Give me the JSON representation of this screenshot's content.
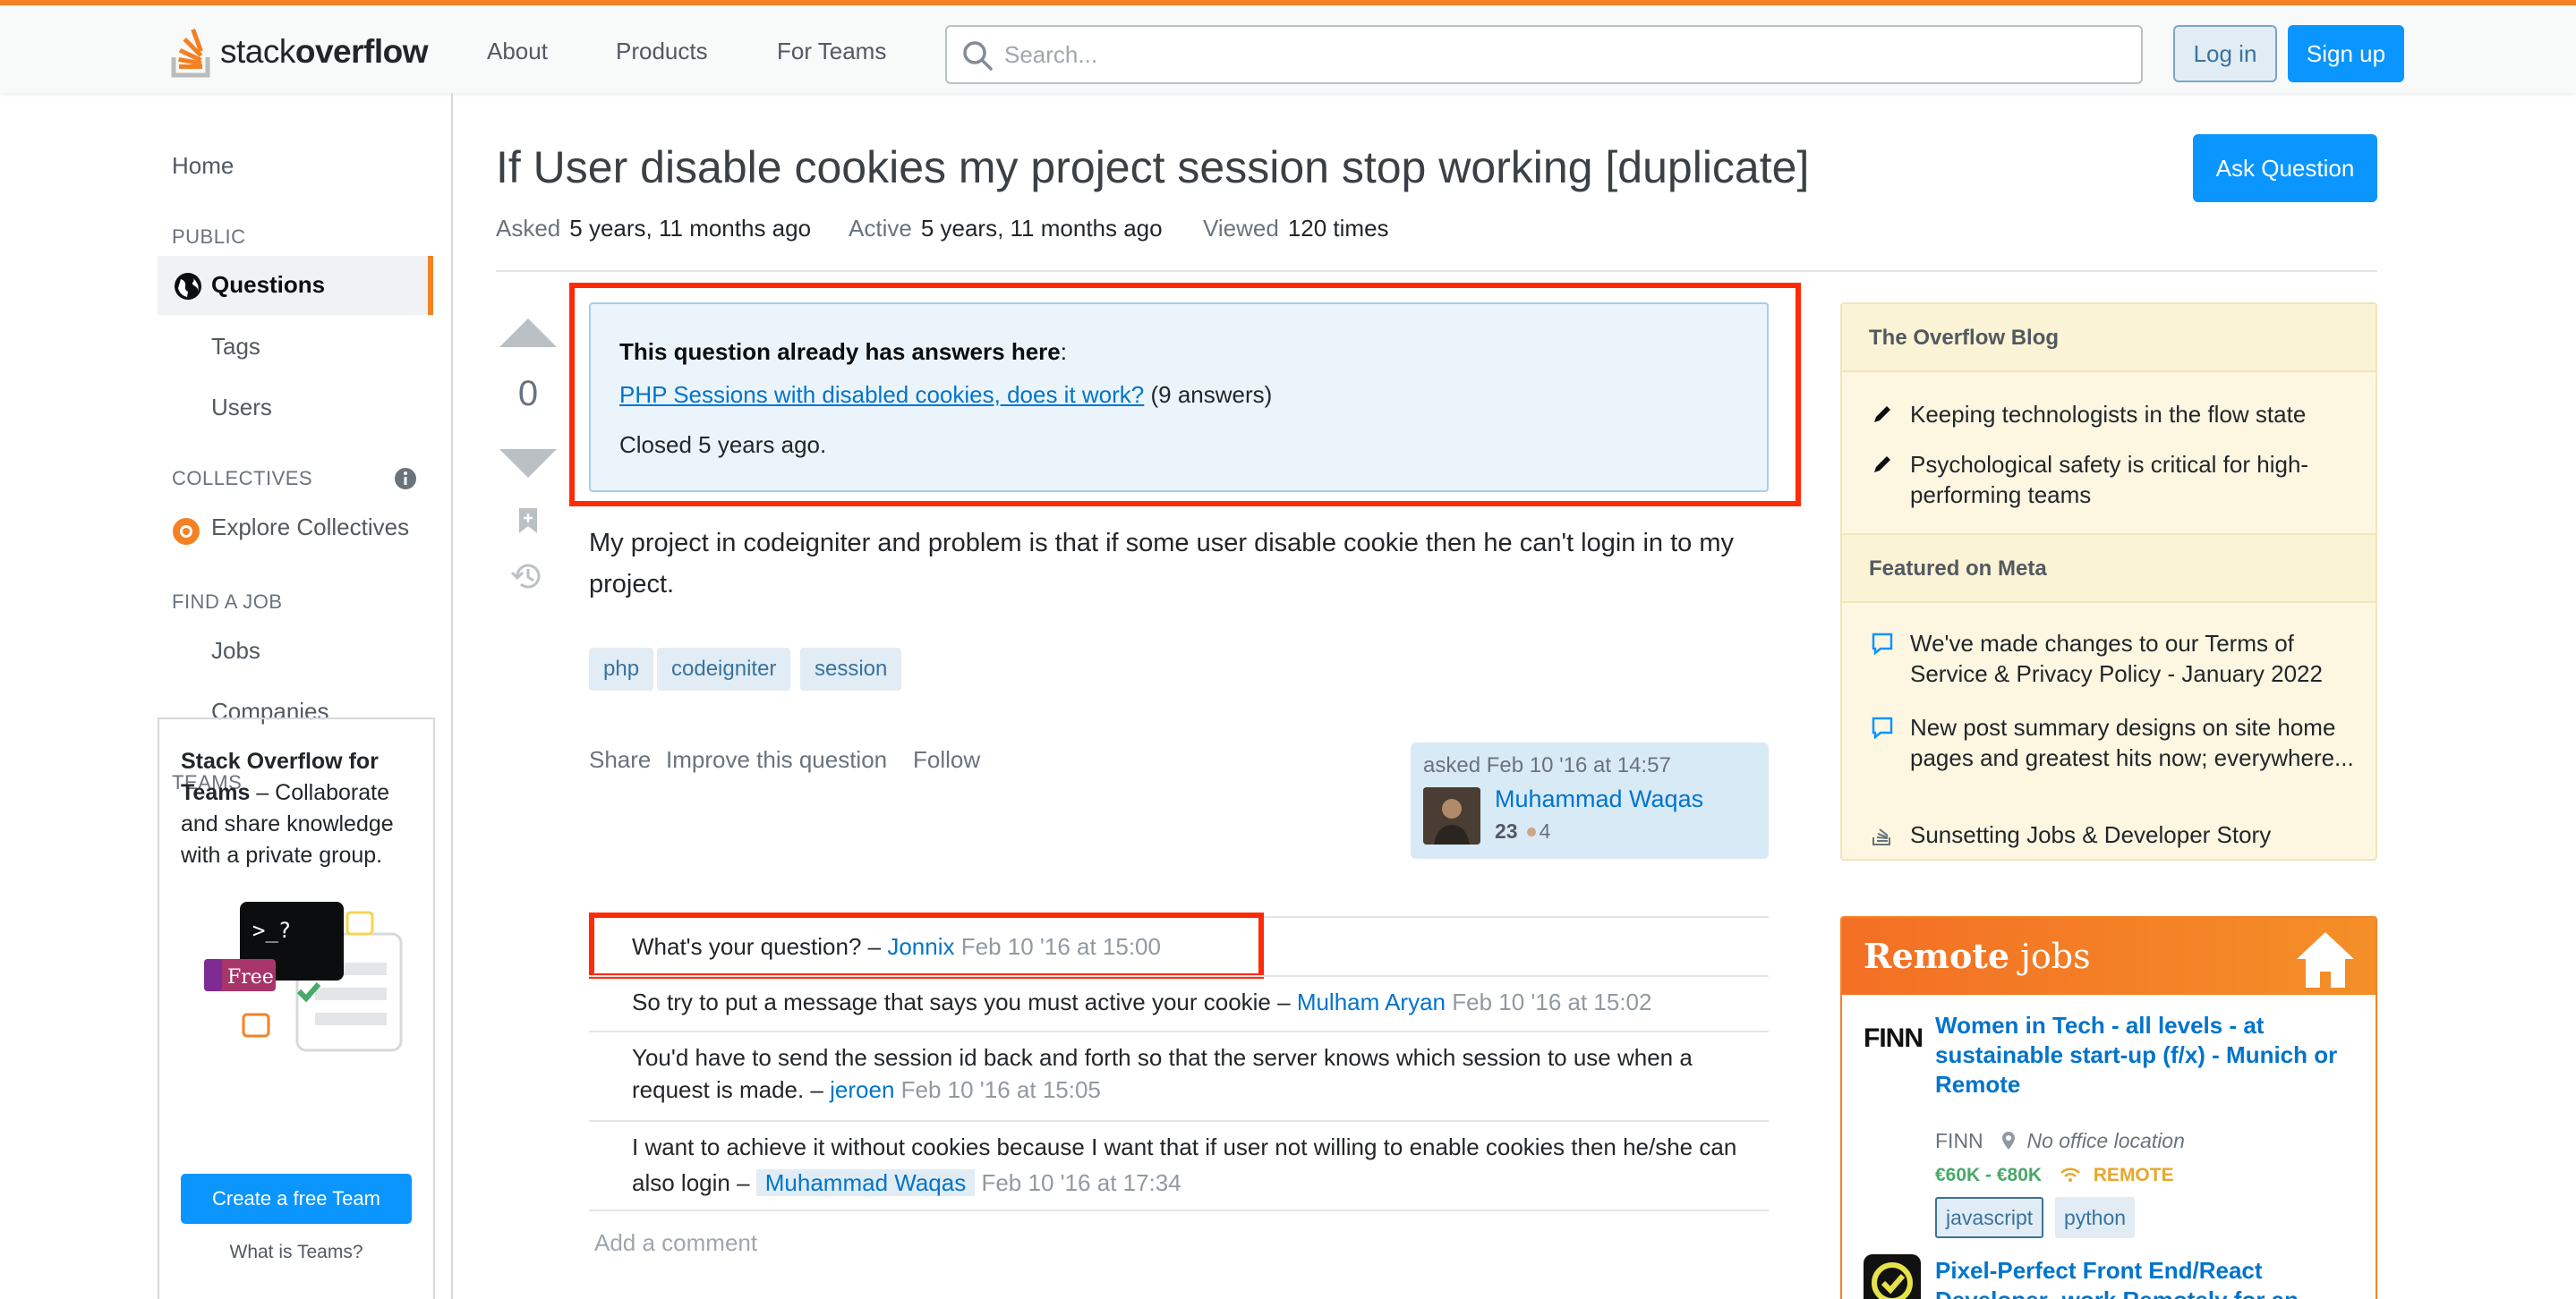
{
  "header": {
    "logo_text_light": "stack",
    "logo_text_bold": "overflow",
    "nav": [
      "About",
      "Products",
      "For Teams"
    ],
    "search_placeholder": "Search...",
    "login_label": "Log in",
    "signup_label": "Sign up",
    "accent_color": "#f48225"
  },
  "sidebar": {
    "home": "Home",
    "public_heading": "PUBLIC",
    "questions": "Questions",
    "tags": "Tags",
    "users": "Users",
    "collectives_heading": "COLLECTIVES",
    "explore_collectives": "Explore Collectives",
    "find_job_heading": "FIND A JOB",
    "jobs": "Jobs",
    "companies": "Companies",
    "teams_heading": "TEAMS",
    "teams_title_bold": "Stack Overflow for Teams",
    "teams_title_rest": " – Collaborate and share knowledge with a private group.",
    "teams_badge": "Free",
    "teams_terminal": ">_?",
    "teams_cta": "Create a free Team",
    "teams_what": "What is Teams?"
  },
  "question": {
    "title": "If User disable cookies my project session stop working [duplicate]",
    "ask_button": "Ask Question",
    "asked_label": "Asked",
    "asked_value": "5 years, 11 months ago",
    "active_label": "Active",
    "active_value": "5 years, 11 months ago",
    "viewed_label": "Viewed",
    "viewed_value": "120 times",
    "votes": "0",
    "duplicate_heading": "This question already has answers here",
    "duplicate_colon": ":",
    "duplicate_link": "PHP Sessions with disabled cookies, does it work?",
    "duplicate_count": " (9 answers)",
    "closed_text": "Closed 5 years ago.",
    "body": "My project in codeigniter and problem is that if some user disable cookie then he can't login in to my project.",
    "tags": [
      "php",
      "codeigniter",
      "session"
    ],
    "menu": [
      "Share",
      "Improve this question",
      "Follow"
    ],
    "owner": {
      "asked": "asked Feb 10 '16 at 14:57",
      "name": "Muhammad Waqas",
      "reputation": "23",
      "bronze": "4"
    }
  },
  "comments": [
    {
      "text": "What's your question? – ",
      "user": "Jonnix",
      "date": "Feb 10 '16 at 15:00"
    },
    {
      "text": "So try to put a message that says you must active your cookie – ",
      "user": "Mulham Aryan",
      "date": "Feb 10 '16 at 15:02"
    },
    {
      "text": "You'd have to send the session id back and forth so that the server knows which session to use when a request is made. – ",
      "user": "jeroen",
      "date": "Feb 10 '16 at 15:05"
    },
    {
      "text": "I want to achieve it without cookies because I want that if user not willing to enable cookies then he/she can also login – ",
      "user": "Muhammad Waqas",
      "date": "Feb 10 '16 at 17:34"
    }
  ],
  "add_comment": "Add a comment",
  "blog": {
    "heading": "The Overflow Blog",
    "items": [
      "Keeping technologists in the flow state",
      "Psychological safety is critical for high-performing teams"
    ],
    "meta_heading": "Featured on Meta",
    "meta_items": [
      "We've made changes to our Terms of Service & Privacy Policy - January 2022",
      "New post summary designs on site home pages and greatest hits now; everywhere...",
      "Sunsetting Jobs & Developer Story"
    ]
  },
  "jobs": {
    "heading_light": "Remote",
    "heading_rest": " jobs",
    "job1_logo": "FINN",
    "job1_title": "Women in Tech - all levels - at sustainable start-up (f/x) - Munich or Remote",
    "job1_company": "FINN",
    "job1_location": "No office location",
    "job1_salary": "€60K - €80K",
    "job1_remote": "REMOTE",
    "job1_tags": [
      "javascript",
      "python"
    ],
    "job2_title": "Pixel-Perfect Front End/React Developer -work Remotely for an"
  }
}
